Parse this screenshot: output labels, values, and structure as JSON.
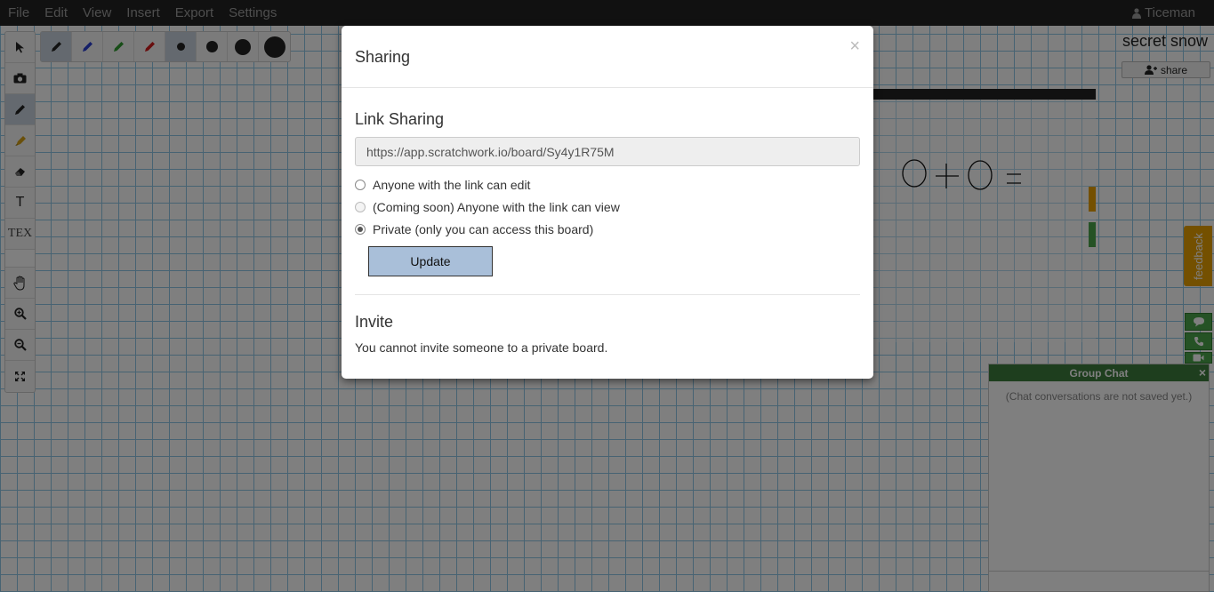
{
  "menubar": {
    "items": [
      "File",
      "Edit",
      "View",
      "Insert",
      "Export",
      "Settings"
    ],
    "user": "Ticeman"
  },
  "toolbar": {
    "tools": [
      "select",
      "camera",
      "pen",
      "highlighter",
      "eraser",
      "text",
      "tex",
      "hand",
      "zoom-in",
      "zoom-out",
      "fullscreen"
    ],
    "text_label": "T",
    "tex_label": "TEX"
  },
  "colorbar": {
    "pens": [
      "#222222",
      "#2a3fd1",
      "#2e9a2e",
      "#d11a1a"
    ],
    "sizes": [
      "small",
      "medium",
      "large",
      "xlarge"
    ]
  },
  "board": {
    "title": "secret snow",
    "share_label": "share"
  },
  "feedback_label": "feedback",
  "chat": {
    "title": "Group Chat",
    "close": "×",
    "note": "(Chat conversations are not saved yet.)"
  },
  "modal": {
    "title": "Sharing",
    "close": "×",
    "link_heading": "Link Sharing",
    "link_url": "https://app.scratchwork.io/board/Sy4y1R75M",
    "options": [
      {
        "label": "Anyone with the link can edit",
        "checked": false,
        "disabled": false
      },
      {
        "label": "(Coming soon) Anyone with the link can view",
        "checked": false,
        "disabled": true
      },
      {
        "label": "Private (only you can access this board)",
        "checked": true,
        "disabled": false
      }
    ],
    "update_label": "Update",
    "invite_heading": "Invite",
    "invite_text": "You cannot invite someone to a private board."
  },
  "colors": {
    "menubar_bg": "#222222",
    "grid": "#8ec6e6",
    "active_tool": "#c8d3df",
    "feedback": "#e8a000",
    "chat_header": "#3d7d3d",
    "update_button": "#a9bfd9"
  }
}
